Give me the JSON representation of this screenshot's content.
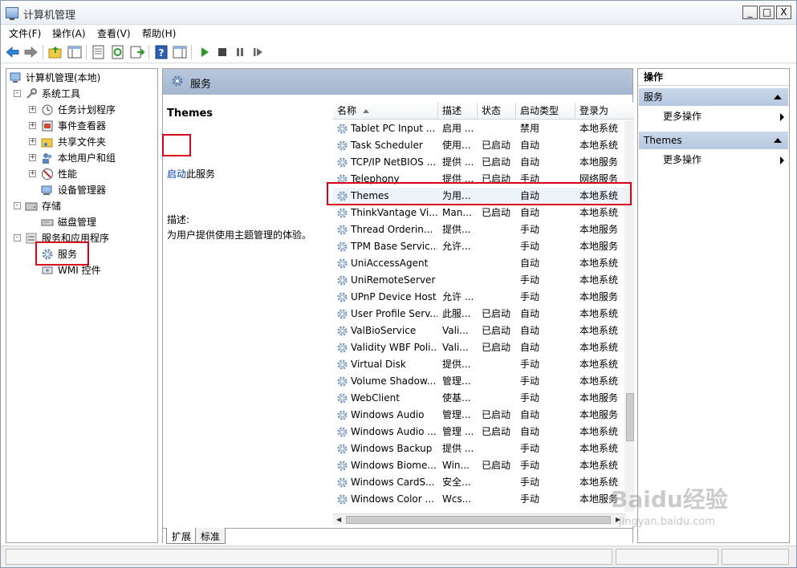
{
  "window": {
    "title": "计算机管理",
    "controls": [
      "_",
      "□",
      "X"
    ]
  },
  "menu": [
    "文件(F)",
    "操作(A)",
    "查看(V)",
    "帮助(H)"
  ],
  "tree": {
    "root": "计算机管理(本地)",
    "items": [
      {
        "label": "系统工具",
        "level": 1,
        "expand": "-"
      },
      {
        "label": "任务计划程序",
        "level": 2,
        "expand": "+"
      },
      {
        "label": "事件查看器",
        "level": 2,
        "expand": "+"
      },
      {
        "label": "共享文件夹",
        "level": 2,
        "expand": "+"
      },
      {
        "label": "本地用户和组",
        "level": 2,
        "expand": "+"
      },
      {
        "label": "性能",
        "level": 2,
        "expand": "+"
      },
      {
        "label": "设备管理器",
        "level": 2,
        "expand": ""
      },
      {
        "label": "存储",
        "level": 1,
        "expand": "-"
      },
      {
        "label": "磁盘管理",
        "level": 2,
        "expand": ""
      },
      {
        "label": "服务和应用程序",
        "level": 1,
        "expand": "-"
      },
      {
        "label": "服务",
        "level": 2,
        "expand": ""
      },
      {
        "label": "WMI 控件",
        "level": 2,
        "expand": ""
      }
    ]
  },
  "center": {
    "header": "服务",
    "detail": {
      "title": "Themes",
      "start_link": "启动",
      "start_suffix": "此服务",
      "desc_label": "描述:",
      "desc": "为用户提供使用主题管理的体验。"
    },
    "columns": [
      "名称",
      "描述",
      "状态",
      "启动类型",
      "登录为"
    ],
    "rows": [
      {
        "name": "Tablet PC Input ...",
        "desc": "启用 ...",
        "status": "",
        "startup": "禁用",
        "logon": "本地系统"
      },
      {
        "name": "Task Scheduler",
        "desc": "使用...",
        "status": "已启动",
        "startup": "自动",
        "logon": "本地系统"
      },
      {
        "name": "TCP/IP NetBIOS ...",
        "desc": "提供 ...",
        "status": "已启动",
        "startup": "自动",
        "logon": "本地服务"
      },
      {
        "name": "Telephony",
        "desc": "提供 ...",
        "status": "已启动",
        "startup": "手动",
        "logon": "网络服务"
      },
      {
        "name": "Themes",
        "desc": "为用...",
        "status": "",
        "startup": "自动",
        "logon": "本地系统"
      },
      {
        "name": "ThinkVantage Vi...",
        "desc": "Man...",
        "status": "已启动",
        "startup": "自动",
        "logon": "本地系统"
      },
      {
        "name": "Thread Orderin...",
        "desc": "提供...",
        "status": "",
        "startup": "手动",
        "logon": "本地服务"
      },
      {
        "name": "TPM Base Servic...",
        "desc": "允许...",
        "status": "",
        "startup": "手动",
        "logon": "本地服务"
      },
      {
        "name": "UniAccessAgent",
        "desc": "",
        "status": "",
        "startup": "自动",
        "logon": "本地系统"
      },
      {
        "name": "UniRemoteServer",
        "desc": "",
        "status": "",
        "startup": "手动",
        "logon": "本地系统"
      },
      {
        "name": "UPnP Device Host",
        "desc": "允许 ...",
        "status": "",
        "startup": "手动",
        "logon": "本地服务"
      },
      {
        "name": "User Profile Serv...",
        "desc": "此服...",
        "status": "已启动",
        "startup": "自动",
        "logon": "本地系统"
      },
      {
        "name": "ValBioService",
        "desc": "Vali...",
        "status": "已启动",
        "startup": "自动",
        "logon": "本地系统"
      },
      {
        "name": "Validity WBF Poli...",
        "desc": "Vali...",
        "status": "已启动",
        "startup": "自动",
        "logon": "本地系统"
      },
      {
        "name": "Virtual Disk",
        "desc": "提供...",
        "status": "",
        "startup": "手动",
        "logon": "本地系统"
      },
      {
        "name": "Volume Shadow...",
        "desc": "管理...",
        "status": "",
        "startup": "手动",
        "logon": "本地系统"
      },
      {
        "name": "WebClient",
        "desc": "使基...",
        "status": "",
        "startup": "手动",
        "logon": "本地服务"
      },
      {
        "name": "Windows Audio",
        "desc": "管理...",
        "status": "已启动",
        "startup": "自动",
        "logon": "本地服务"
      },
      {
        "name": "Windows Audio ...",
        "desc": "管理 ...",
        "status": "已启动",
        "startup": "自动",
        "logon": "本地系统"
      },
      {
        "name": "Windows Backup",
        "desc": "提供 ...",
        "status": "",
        "startup": "手动",
        "logon": "本地系统"
      },
      {
        "name": "Windows Biome...",
        "desc": "Win...",
        "status": "已启动",
        "startup": "手动",
        "logon": "本地系统"
      },
      {
        "name": "Windows CardS...",
        "desc": "安全...",
        "status": "",
        "startup": "手动",
        "logon": "本地系统"
      },
      {
        "name": "Windows Color ...",
        "desc": "Wcs...",
        "status": "",
        "startup": "手动",
        "logon": "本地服务"
      }
    ],
    "tabs": [
      "扩展",
      "标准"
    ]
  },
  "actions": {
    "title": "操作",
    "sections": [
      {
        "name": "服务",
        "item": "更多操作"
      },
      {
        "name": "Themes",
        "item": "更多操作"
      }
    ]
  },
  "watermark": {
    "logo": "Baidu经验",
    "url": "jingyan.baidu.com"
  },
  "colors": {
    "highlight": "#d9001b",
    "header": "#a4b7d0",
    "link": "#0645ad"
  }
}
